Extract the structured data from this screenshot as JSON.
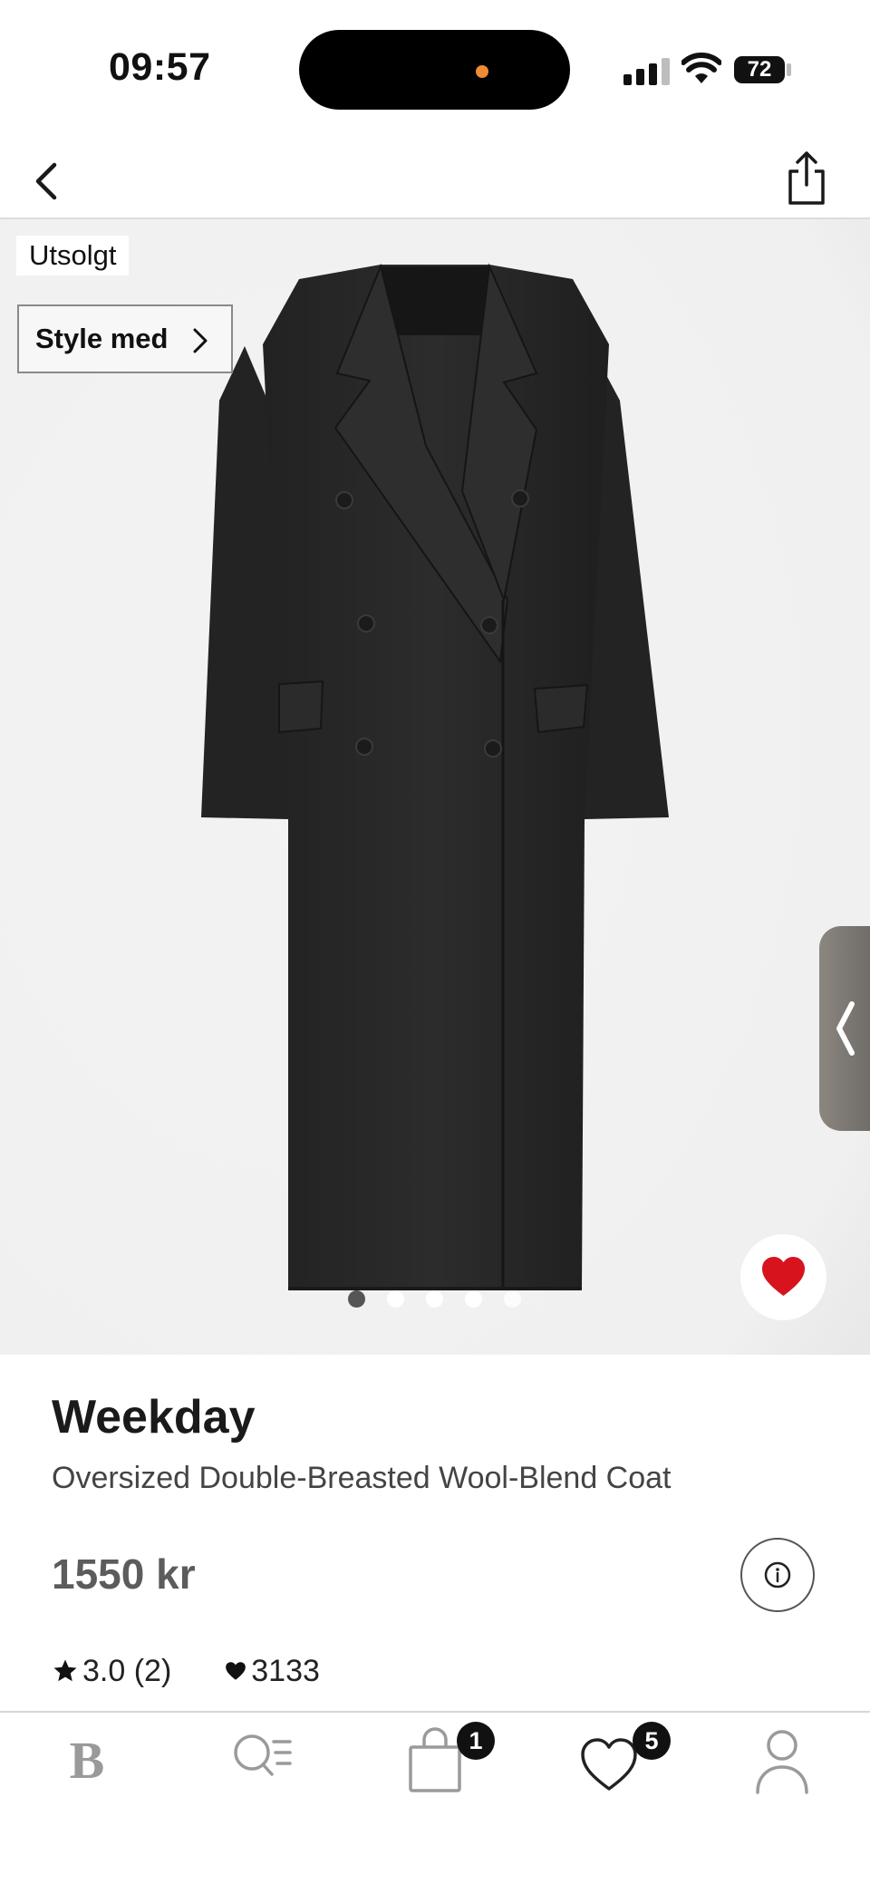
{
  "status_bar": {
    "time": "09:57",
    "battery": "72"
  },
  "product": {
    "sold_out_label": "Utsolgt",
    "style_with_label": "Style med",
    "brand": "Weekday",
    "name": "Oversized Double-Breasted Wool-Blend Coat",
    "price": "1550 kr",
    "rating": "3.0 (2)",
    "likes": "3133",
    "image_count": 5,
    "current_image": 1,
    "favorited": true
  },
  "tab_bar": {
    "items": [
      {
        "id": "home",
        "icon": "brand-b-icon"
      },
      {
        "id": "search",
        "icon": "search-list-icon"
      },
      {
        "id": "bag",
        "icon": "shopping-bag-icon",
        "badge": "1"
      },
      {
        "id": "wishlist",
        "icon": "heart-icon",
        "badge": "5"
      },
      {
        "id": "profile",
        "icon": "person-icon"
      }
    ]
  },
  "colors": {
    "favorite": "#d7141e",
    "image_bg": "#f1f1f1",
    "coat": "#262626"
  }
}
